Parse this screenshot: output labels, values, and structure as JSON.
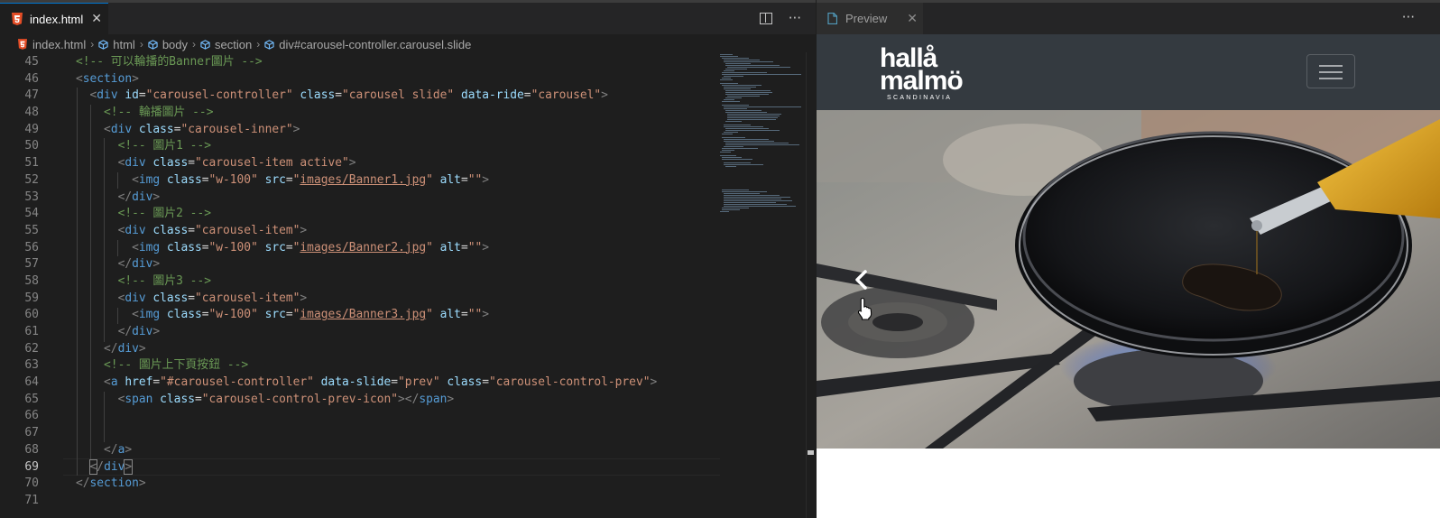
{
  "editor": {
    "tab": {
      "label": "index.html",
      "close": "✕"
    },
    "actions": {
      "more": "···"
    },
    "breadcrumb": [
      {
        "label": "index.html",
        "icon": "html5-icon"
      },
      {
        "label": "html",
        "icon": "element-icon"
      },
      {
        "label": "body",
        "icon": "element-icon"
      },
      {
        "label": "section",
        "icon": "element-icon"
      },
      {
        "label": "div#carousel-controller.carousel.slide",
        "icon": "element-icon"
      }
    ],
    "line_numbers": [
      "45",
      "46",
      "47",
      "48",
      "49",
      "50",
      "51",
      "52",
      "53",
      "54",
      "55",
      "56",
      "57",
      "58",
      "59",
      "60",
      "61",
      "62",
      "63",
      "64",
      "65",
      "66",
      "67",
      "68",
      "69",
      "70",
      "71"
    ],
    "current_line": "69"
  },
  "preview": {
    "tab": {
      "label": "Preview",
      "close": "✕"
    },
    "more": "···",
    "logo": {
      "line1": "hallå",
      "line2": "malmö",
      "sub": "SCANDINAVIA"
    },
    "colors": {
      "navbar": "#343a40",
      "editor_bg": "#1e1e1e",
      "tab_accent": "#0078d4"
    }
  }
}
